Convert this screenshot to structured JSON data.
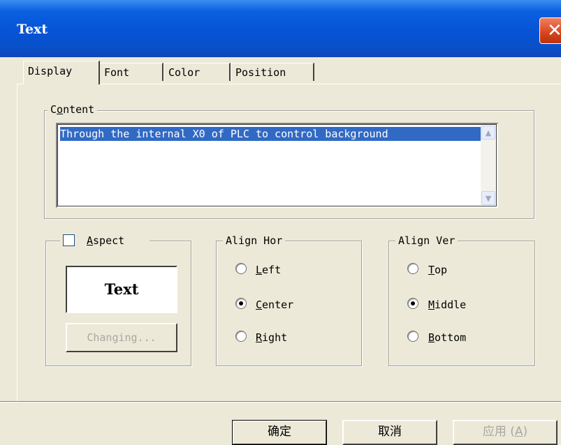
{
  "window": {
    "title": "Text"
  },
  "tabs": [
    {
      "label": "Display",
      "active": true
    },
    {
      "label": "Font",
      "active": false
    },
    {
      "label": "Color",
      "active": false
    },
    {
      "label": "Position",
      "active": false
    }
  ],
  "content": {
    "legend_pre": "C",
    "legend_accel": "o",
    "legend_post": "ntent",
    "value": "Through the internal X0 of PLC to control background"
  },
  "aspect": {
    "legend_accel": "A",
    "legend_post": "spect",
    "checked": false,
    "preview_text": "Text",
    "changing_label": "Changing..."
  },
  "align_hor": {
    "legend": "Align Hor",
    "options": [
      {
        "accel": "L",
        "rest": "eft",
        "selected": false
      },
      {
        "accel": "C",
        "rest": "enter",
        "selected": true
      },
      {
        "accel": "R",
        "rest": "ight",
        "selected": false
      }
    ]
  },
  "align_ver": {
    "legend": "Align Ver",
    "options": [
      {
        "accel": "T",
        "rest": "op",
        "selected": false
      },
      {
        "accel": "M",
        "rest": "iddle",
        "selected": true
      },
      {
        "accel": "B",
        "rest": "ottom",
        "selected": false
      }
    ]
  },
  "footer": {
    "ok_label": "确定",
    "cancel_label": "取消",
    "apply_pre": "应用 (",
    "apply_accel": "A",
    "apply_post": ")"
  },
  "colors": {
    "title_bar": "#0654d6",
    "selection": "#316ac5",
    "dialog_bg": "#ece9d8",
    "close_button": "#d8431c"
  }
}
